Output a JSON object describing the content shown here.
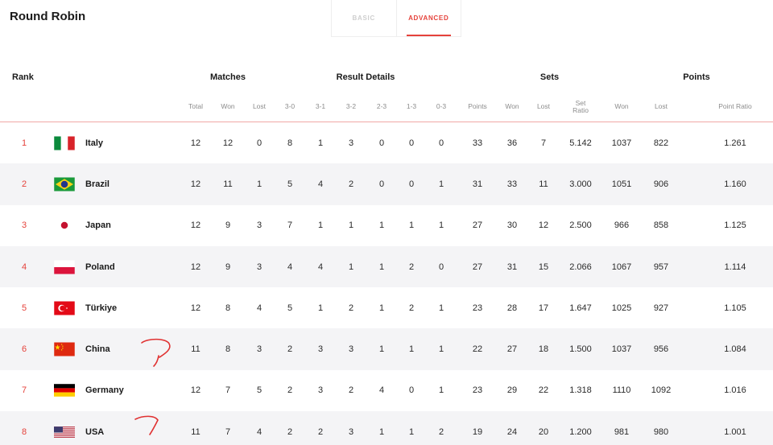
{
  "title": "Round Robin",
  "tabs": [
    {
      "label": "BASIC",
      "active": false
    },
    {
      "label": "ADVANCED",
      "active": true
    }
  ],
  "accent_color": "#e5423b",
  "groups": {
    "rank": "Rank",
    "matches": "Matches",
    "result_details": "Result Details",
    "sets": "Sets",
    "points": "Points"
  },
  "subheaders": {
    "total": "Total",
    "won": "Won",
    "lost": "Lost",
    "r30": "3-0",
    "r31": "3-1",
    "r32": "3-2",
    "r23": "2-3",
    "r13": "1-3",
    "r03": "0-3",
    "points": "Points",
    "sets_won": "Won",
    "sets_lost": "Lost",
    "set_ratio": "Set\nRatio",
    "pts_won": "Won",
    "pts_lost": "Lost",
    "point_ratio": "Point Ratio"
  },
  "rows": [
    {
      "rank": "1",
      "flag": "italy-flag",
      "team": "Italy",
      "total": "12",
      "won": "12",
      "lost": "0",
      "r30": "8",
      "r31": "1",
      "r32": "3",
      "r23": "0",
      "r13": "0",
      "r03": "0",
      "points": "33",
      "sets_won": "36",
      "sets_lost": "7",
      "set_ratio": "5.142",
      "pts_won": "1037",
      "pts_lost": "822",
      "point_ratio": "1.261"
    },
    {
      "rank": "2",
      "flag": "brazil-flag",
      "team": "Brazil",
      "total": "12",
      "won": "11",
      "lost": "1",
      "r30": "5",
      "r31": "4",
      "r32": "2",
      "r23": "0",
      "r13": "0",
      "r03": "1",
      "points": "31",
      "sets_won": "33",
      "sets_lost": "11",
      "set_ratio": "3.000",
      "pts_won": "1051",
      "pts_lost": "906",
      "point_ratio": "1.160"
    },
    {
      "rank": "3",
      "flag": "japan-flag",
      "team": "Japan",
      "total": "12",
      "won": "9",
      "lost": "3",
      "r30": "7",
      "r31": "1",
      "r32": "1",
      "r23": "1",
      "r13": "1",
      "r03": "1",
      "points": "27",
      "sets_won": "30",
      "sets_lost": "12",
      "set_ratio": "2.500",
      "pts_won": "966",
      "pts_lost": "858",
      "point_ratio": "1.125"
    },
    {
      "rank": "4",
      "flag": "poland-flag",
      "team": "Poland",
      "total": "12",
      "won": "9",
      "lost": "3",
      "r30": "4",
      "r31": "4",
      "r32": "1",
      "r23": "1",
      "r13": "2",
      "r03": "0",
      "points": "27",
      "sets_won": "31",
      "sets_lost": "15",
      "set_ratio": "2.066",
      "pts_won": "1067",
      "pts_lost": "957",
      "point_ratio": "1.114"
    },
    {
      "rank": "5",
      "flag": "turkiye-flag",
      "team": "Türkiye",
      "total": "12",
      "won": "8",
      "lost": "4",
      "r30": "5",
      "r31": "1",
      "r32": "2",
      "r23": "1",
      "r13": "2",
      "r03": "1",
      "points": "23",
      "sets_won": "28",
      "sets_lost": "17",
      "set_ratio": "1.647",
      "pts_won": "1025",
      "pts_lost": "927",
      "point_ratio": "1.105"
    },
    {
      "rank": "6",
      "flag": "china-flag",
      "team": "China",
      "total": "11",
      "won": "8",
      "lost": "3",
      "r30": "2",
      "r31": "3",
      "r32": "3",
      "r23": "1",
      "r13": "1",
      "r03": "1",
      "points": "22",
      "sets_won": "27",
      "sets_lost": "18",
      "set_ratio": "1.500",
      "pts_won": "1037",
      "pts_lost": "956",
      "point_ratio": "1.084"
    },
    {
      "rank": "7",
      "flag": "germany-flag",
      "team": "Germany",
      "total": "12",
      "won": "7",
      "lost": "5",
      "r30": "2",
      "r31": "3",
      "r32": "2",
      "r23": "4",
      "r13": "0",
      "r03": "1",
      "points": "23",
      "sets_won": "29",
      "sets_lost": "22",
      "set_ratio": "1.318",
      "pts_won": "1110",
      "pts_lost": "1092",
      "point_ratio": "1.016"
    },
    {
      "rank": "8",
      "flag": "usa-flag",
      "team": "USA",
      "total": "11",
      "won": "7",
      "lost": "4",
      "r30": "2",
      "r31": "2",
      "r32": "3",
      "r23": "1",
      "r13": "1",
      "r03": "2",
      "points": "19",
      "sets_won": "24",
      "sets_lost": "20",
      "set_ratio": "1.200",
      "pts_won": "981",
      "pts_lost": "980",
      "point_ratio": "1.001"
    }
  ]
}
